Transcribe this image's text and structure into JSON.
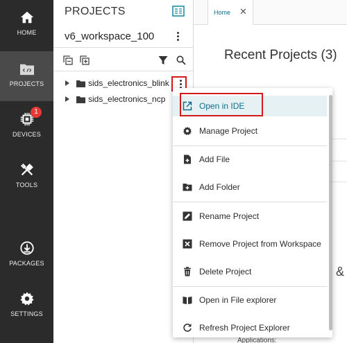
{
  "nav": {
    "items": [
      {
        "label": "HOME",
        "icon": "home-icon"
      },
      {
        "label": "PROJECTS",
        "icon": "projects-icon",
        "active": true
      },
      {
        "label": "DEVICES",
        "icon": "chip-icon",
        "badge": "1"
      },
      {
        "label": "TOOLS",
        "icon": "tools-icon"
      },
      {
        "label": "PACKAGES",
        "icon": "download-icon"
      },
      {
        "label": "SETTINGS",
        "icon": "gear-icon"
      }
    ]
  },
  "panel": {
    "title": "PROJECTS",
    "workspace": "v6_workspace_100",
    "projects": [
      {
        "name": "sids_electronics_blink"
      },
      {
        "name": "sids_electronics_ncp"
      }
    ]
  },
  "tabs": [
    {
      "label": "Home"
    }
  ],
  "content": {
    "title": "Recent Projects (3)",
    "fragment_ampersand": "&",
    "fragment_applications": "Applications:"
  },
  "menu": {
    "items": [
      {
        "label": "Open in IDE",
        "icon": "open-external-icon",
        "selected": true
      },
      {
        "label": "Manage Project",
        "icon": "gear-icon"
      },
      {
        "label": "Add File",
        "icon": "file-plus-icon"
      },
      {
        "label": "Add Folder",
        "icon": "folder-plus-icon"
      },
      {
        "label": "Rename Project",
        "icon": "edit-icon"
      },
      {
        "label": "Remove Project from Workspace",
        "icon": "close-box-icon"
      },
      {
        "label": "Delete Project",
        "icon": "trash-icon"
      },
      {
        "label": "Open in File explorer",
        "icon": "book-open-icon"
      },
      {
        "label": "Refresh Project Explorer",
        "icon": "refresh-icon"
      }
    ]
  },
  "colors": {
    "nav_bg": "#2b2b2b",
    "accent": "#0d6e8a",
    "highlight": "#d11a1a",
    "badge": "#e53935"
  }
}
